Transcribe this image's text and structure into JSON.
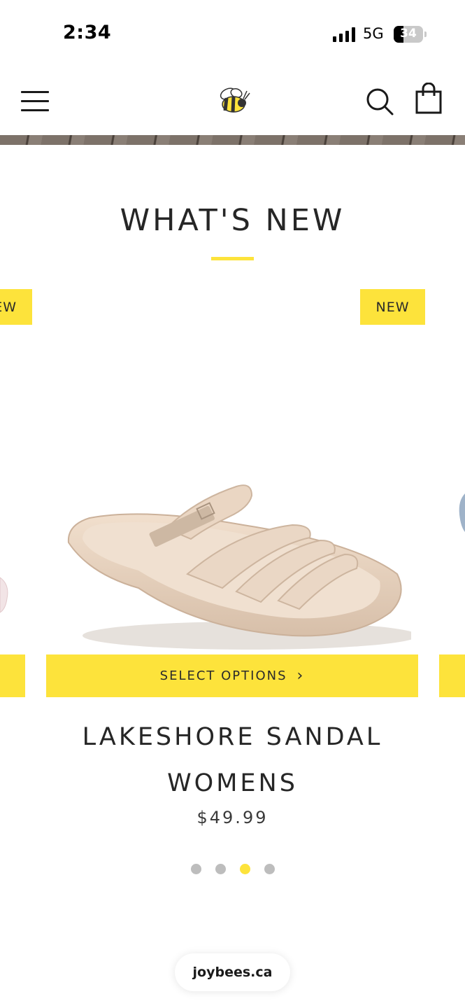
{
  "status_bar": {
    "time": "2:34",
    "network": "5G",
    "battery_level": "34"
  },
  "header": {
    "menu_icon": "hamburger-menu-icon",
    "logo_icon": "bee-logo-icon",
    "search_icon": "search-icon",
    "cart_icon": "shopping-bag-icon"
  },
  "section": {
    "title": "WHAT'S NEW",
    "accent_color": "#fde33b"
  },
  "carousel": {
    "prev_badge": "EW",
    "badge": "NEW",
    "select_label": "SELECT OPTIONS",
    "select_chevron": "›",
    "product_name": "LAKESHORE SANDAL WOMENS",
    "price": "$49.99",
    "current_slide": 3,
    "total_slides": 4
  },
  "browser": {
    "url": "joybees.ca"
  }
}
